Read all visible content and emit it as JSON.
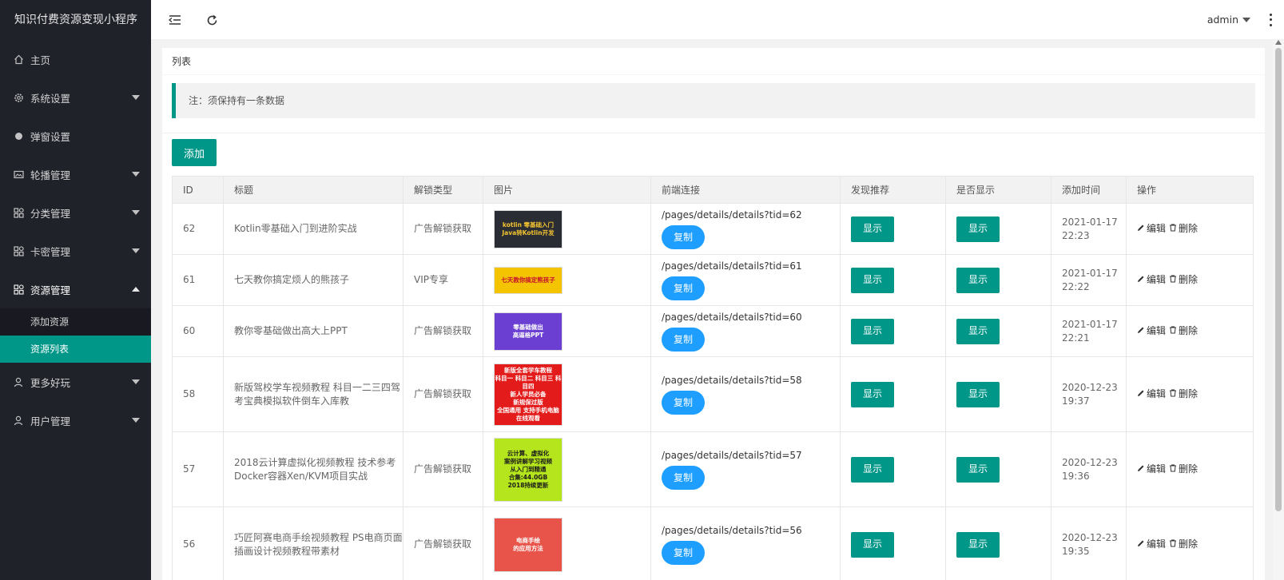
{
  "app": {
    "title": "知识付费资源变现小程序"
  },
  "sidebar": {
    "items": [
      {
        "label": "主页",
        "icon": "home-icon"
      },
      {
        "label": "系统设置",
        "icon": "gear-icon"
      },
      {
        "label": "弹窗设置",
        "icon": "circle-icon"
      },
      {
        "label": "轮播管理",
        "icon": "image-icon"
      },
      {
        "label": "分类管理",
        "icon": "grid-icon"
      },
      {
        "label": "卡密管理",
        "icon": "grid-icon"
      },
      {
        "label": "资源管理",
        "icon": "grid-icon"
      },
      {
        "label": "更多好玩",
        "icon": "user-icon"
      },
      {
        "label": "用户管理",
        "icon": "user-icon"
      }
    ],
    "submenu": [
      {
        "label": "添加资源"
      },
      {
        "label": "资源列表"
      }
    ]
  },
  "header": {
    "user": "admin"
  },
  "card": {
    "title": "列表",
    "note": "注：须保持有一条数据",
    "add_label": "添加"
  },
  "table": {
    "columns": [
      "ID",
      "标题",
      "解锁类型",
      "图片",
      "前端连接",
      "发现推荐",
      "是否显示",
      "添加时间",
      "操作"
    ],
    "copy_label": "复制",
    "show_label": "显示",
    "edit_label": "编辑",
    "delete_label": "删除",
    "rows": [
      {
        "id": "62",
        "title": "Kotlin零基础入门到进阶实战",
        "unlock": "广告解锁获取",
        "link": "/pages/details/details?tid=62",
        "date": "2021-01-17",
        "time": "22:23",
        "img_text": "kotlin 零基础入门\nJava转Kotlin开发",
        "img_bg": "#2a2d34",
        "img_color": "#f4c430"
      },
      {
        "id": "61",
        "title": "七天教你搞定烦人的熊孩子",
        "unlock": "VIP专享",
        "link": "/pages/details/details?tid=61",
        "date": "2021-01-17",
        "time": "22:22",
        "img_text": "七天教你搞定熊孩子",
        "img_bg": "#f5c400",
        "img_color": "#c8102e"
      },
      {
        "id": "60",
        "title": "教你零基础做出高大上PPT",
        "unlock": "广告解锁获取",
        "link": "/pages/details/details?tid=60",
        "date": "2021-01-17",
        "time": "22:21",
        "img_text": "零基础做出\n高逼格PPT",
        "img_bg": "#6a3fd1",
        "img_color": "#ffffff"
      },
      {
        "id": "58",
        "title": "新版驾校学车视频教程 科目一二三四驾考宝典模拟软件倒车入库教",
        "unlock": "广告解锁获取",
        "link": "/pages/details/details?tid=58",
        "date": "2020-12-23",
        "time": "19:37",
        "img_text": "新版全套学车教程\n科目一 科目二 科目三 科目四\n新人学员必备\n新规保过版\n全国通用 支持手机电脑在线观看",
        "img_bg": "#e31b1b",
        "img_color": "#ffffff"
      },
      {
        "id": "57",
        "title": "2018云计算虚拟化视频教程 技术参考Docker容器Xen/KVM项目实战",
        "unlock": "广告解锁获取",
        "link": "/pages/details/details?tid=57",
        "date": "2020-12-23",
        "time": "19:36",
        "img_text": "云计算、虚拟化\n案例讲解学习视频\n从入门到精通\n合集:44.0GB\n2018持续更新",
        "img_bg": "#b5e61d",
        "img_color": "#1a1a1a"
      },
      {
        "id": "56",
        "title": "巧匠阿赛电商手绘视频教程 PS电商页面插画设计视频教程带素材",
        "unlock": "广告解锁获取",
        "link": "/pages/details/details?tid=56",
        "date": "2020-12-23",
        "time": "19:35",
        "img_text": "电商手绘\n的应用方法",
        "img_bg": "#e8534a",
        "img_color": "#ffffff"
      }
    ]
  }
}
